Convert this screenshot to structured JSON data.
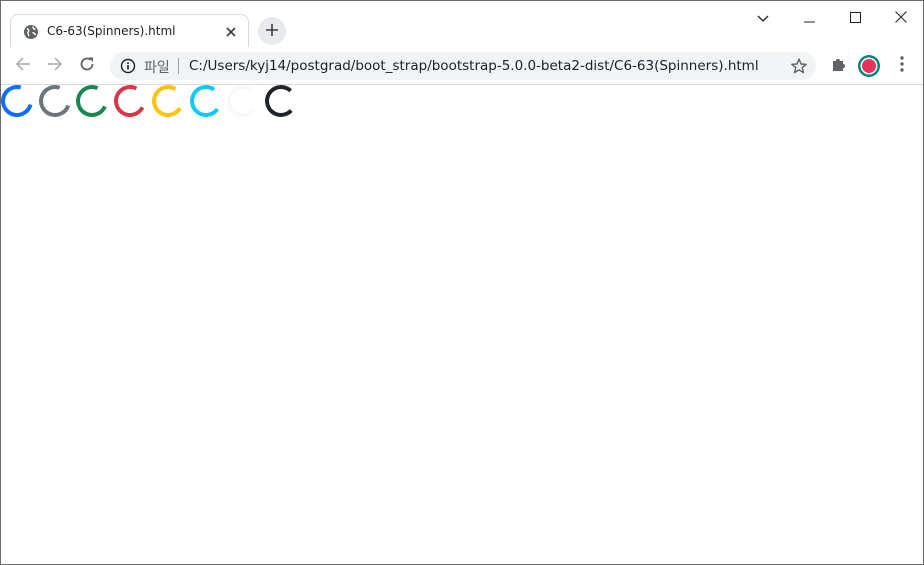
{
  "browser": {
    "tab": {
      "title": "C6-63(Spinners).html",
      "favicon": "globe-icon"
    },
    "new_tab_icon": "plus-icon",
    "window_controls": [
      "chevron-down-icon",
      "minimize-icon",
      "maximize-icon",
      "close-icon"
    ],
    "toolbar": {
      "back_icon": "back-arrow-icon",
      "forward_icon": "forward-arrow-icon",
      "reload_icon": "reload-icon",
      "omnibox": {
        "scheme_label": "파일",
        "url": "C:/Users/kyj14/postgrad/boot_strap/bootstrap-5.0.0-beta2-dist/C6-63(Spinners).html"
      },
      "extensions_icon": "puzzle-icon",
      "menu_icon": "kebab-menu-icon"
    }
  },
  "page": {
    "spinners": [
      {
        "variant": "primary",
        "color": "#0d6efd"
      },
      {
        "variant": "secondary",
        "color": "#6c757d"
      },
      {
        "variant": "success",
        "color": "#198754"
      },
      {
        "variant": "danger",
        "color": "#dc3545"
      },
      {
        "variant": "warning",
        "color": "#ffc107"
      },
      {
        "variant": "info",
        "color": "#0dcaf0"
      },
      {
        "variant": "light",
        "color": "#f8f9fa"
      },
      {
        "variant": "dark",
        "color": "#212529"
      }
    ]
  }
}
